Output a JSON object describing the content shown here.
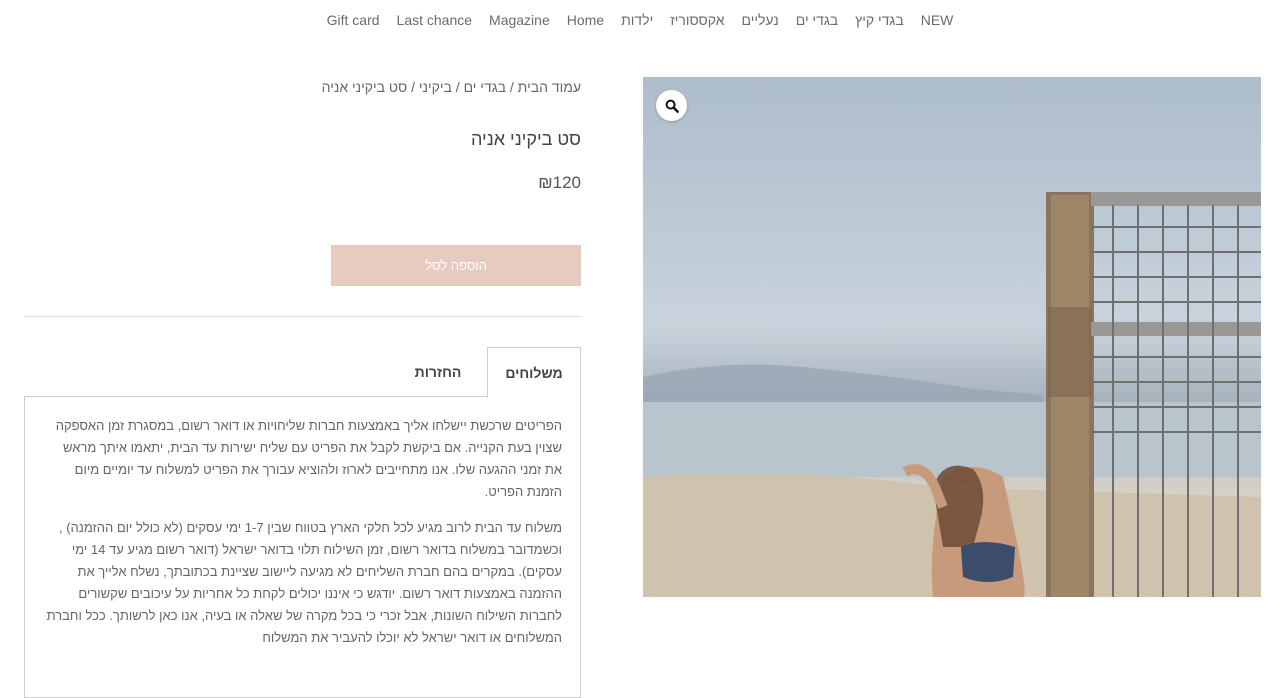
{
  "nav": {
    "items": [
      "NEW",
      "בגדי קיץ",
      "בגדי ים",
      "נעליים",
      "אקססוריז",
      "ילדות",
      "Home",
      "Magazine",
      "Last chance",
      "Gift card"
    ]
  },
  "breadcrumb": {
    "home": "עמוד הבית",
    "category": "בגדי ים",
    "subcategory": "ביקיני",
    "current": "סט ביקיני אניה",
    "separator": " / "
  },
  "product": {
    "title": "סט ביקיני אניה",
    "price": "₪120",
    "add_to_cart_label": "הוספה לסל",
    "image_icon": "zoom-magnifier-icon"
  },
  "tabs": {
    "shipping_label": "משלוחים",
    "returns_label": "החזרות",
    "active": "shipping"
  },
  "shipping_text": {
    "p1": "הפריטים שרכשת יישלחו אליך באמצעות חברות שליחויות או דואר רשום, במסגרת זמן האספקה שצוין בעת הקנייה. אם ביקשת לקבל את הפריט עם שליח ישירות עד הבית, יתאמו איתך מראש את זמני ההגעה שלו. אנו מתחייבים לארוז ולהוציא עבורך את הפריט למשלוח עד יומיים מיום הזמנת הפריט.",
    "p2": "משלוח עד הבית לרוב מגיע לכל חלקי הארץ בטווח שבין 1-7 ימי עסקים (לא כולל יום ההזמנה) , וכשמדובר במשלוח בדואר רשום, זמן השילוח תלוי בדואר ישראל (דואר רשום מגיע עד 14 ימי עסקים). במקרים בהם חברת השליחים לא מגיעה ליישוב שציינת בכתובתך, נשלח אלייך את ההזמנה באמצעות דואר רשום. יודגש כי איננו יכולים לקחת כל אחריות על עיכובים שקשורים לחברות השילוח השונות, אבל זכרי כי בכל מקרה של שאלה או בעיה, אנו כאן לרשותך. ככל וחברת המשלוחים או דואר ישראל לא יוכלו להעביר את המשלוח"
  },
  "colors": {
    "add_to_cart_bg": "#e7cbc1",
    "text": "#555555",
    "border": "#cccccc"
  }
}
